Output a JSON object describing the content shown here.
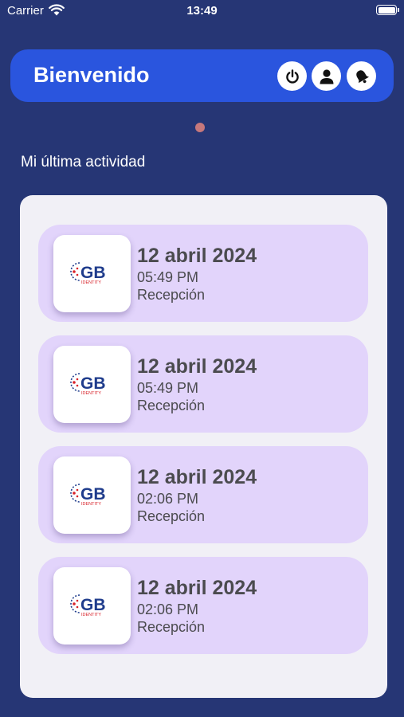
{
  "status_bar": {
    "carrier": "Carrier",
    "time": "13:49",
    "wifi_icon": "wifi-icon",
    "battery_icon": "battery-icon"
  },
  "header": {
    "title": "Bienvenido",
    "buttons": [
      {
        "icon": "power-icon"
      },
      {
        "icon": "user-icon"
      },
      {
        "icon": "bell-icon"
      }
    ]
  },
  "section_title": "Mi última actividad",
  "logo": {
    "text_main": "GB",
    "text_sub": "IDENTITY"
  },
  "activities": [
    {
      "date": "12 abril 2024",
      "time": "05:49 PM",
      "place": "Recepción"
    },
    {
      "date": "12 abril 2024",
      "time": "05:49 PM",
      "place": "Recepción"
    },
    {
      "date": "12 abril 2024",
      "time": "02:06 PM",
      "place": "Recepción"
    },
    {
      "date": "12 abril 2024",
      "time": "02:06 PM",
      "place": "Recepción"
    }
  ],
  "colors": {
    "background": "#263675",
    "header": "#2a55de",
    "card": "#f1f0f6",
    "item": "#e2d4fb",
    "logo_blue": "#1f3c8c",
    "logo_red": "#d8232a",
    "indicator_dot": "#c6787c"
  }
}
